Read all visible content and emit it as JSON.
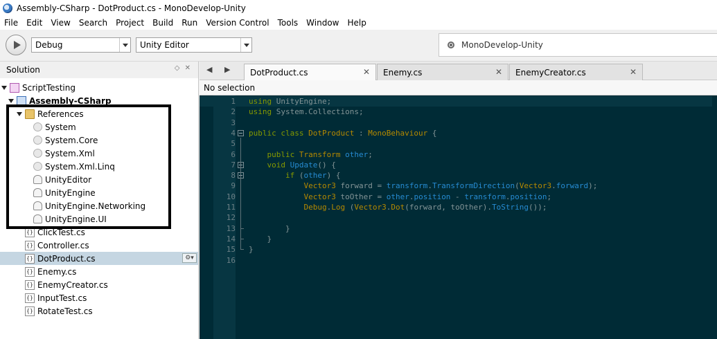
{
  "window": {
    "title": "Assembly-CSharp - DotProduct.cs - MonoDevelop-Unity"
  },
  "menu": [
    "File",
    "Edit",
    "View",
    "Search",
    "Project",
    "Build",
    "Run",
    "Version Control",
    "Tools",
    "Window",
    "Help"
  ],
  "toolbar": {
    "config": "Debug",
    "target": "Unity Editor",
    "status": "MonoDevelop-Unity"
  },
  "solution": {
    "title": "Solution",
    "controls": "◇ ✕",
    "solution_name": "ScriptTesting",
    "project_name": "Assembly-CSharp",
    "references_label": "References",
    "references": [
      "System",
      "System.Core",
      "System.Xml",
      "System.Xml.Linq",
      "UnityEditor",
      "UnityEngine",
      "UnityEngine.Networking",
      "UnityEngine.UI"
    ],
    "files": [
      "ClickTest.cs",
      "Controller.cs",
      "DotProduct.cs",
      "Enemy.cs",
      "EnemyCreator.cs",
      "InputTest.cs",
      "RotateTest.cs"
    ],
    "selected_file": "DotProduct.cs"
  },
  "editor": {
    "tabs": [
      {
        "label": "DotProduct.cs",
        "active": true
      },
      {
        "label": "Enemy.cs",
        "active": false
      },
      {
        "label": "EnemyCreator.cs",
        "active": false
      }
    ],
    "selection_status": "No selection",
    "current_line": 1,
    "lines": [
      [
        [
          "kw",
          "using "
        ],
        [
          "pl",
          "UnityEngine;"
        ]
      ],
      [
        [
          "kw",
          "using "
        ],
        [
          "pl",
          "System.Collections;"
        ]
      ],
      [],
      [
        [
          "kw",
          "public class "
        ],
        [
          "ty",
          "DotProduct"
        ],
        [
          "pl",
          " : "
        ],
        [
          "ty",
          "MonoBehaviour"
        ],
        [
          "pl",
          " {"
        ]
      ],
      [],
      [
        [
          "pl",
          "    "
        ],
        [
          "kw",
          "public "
        ],
        [
          "ty",
          "Transform "
        ],
        [
          "mb",
          "other"
        ],
        [
          "pl",
          ";"
        ]
      ],
      [
        [
          "pl",
          "    "
        ],
        [
          "kw",
          "void "
        ],
        [
          "mb",
          "Update"
        ],
        [
          "pl",
          "() {"
        ]
      ],
      [
        [
          "pl",
          "        "
        ],
        [
          "kw",
          "if "
        ],
        [
          "pl",
          "("
        ],
        [
          "mb",
          "other"
        ],
        [
          "pl",
          ") {"
        ]
      ],
      [
        [
          "pl",
          "            "
        ],
        [
          "ty",
          "Vector3 "
        ],
        [
          "pl",
          "forward = "
        ],
        [
          "mb",
          "transform"
        ],
        [
          "pl",
          "."
        ],
        [
          "mb",
          "TransformDirection"
        ],
        [
          "pl",
          "("
        ],
        [
          "ty",
          "Vector3"
        ],
        [
          "pl",
          "."
        ],
        [
          "mb",
          "forward"
        ],
        [
          "pl",
          ");"
        ]
      ],
      [
        [
          "pl",
          "            "
        ],
        [
          "ty",
          "Vector3 "
        ],
        [
          "pl",
          "toOther = "
        ],
        [
          "mb",
          "other"
        ],
        [
          "pl",
          "."
        ],
        [
          "mb",
          "position"
        ],
        [
          "pl",
          " - "
        ],
        [
          "mb",
          "transform"
        ],
        [
          "pl",
          "."
        ],
        [
          "mb",
          "position"
        ],
        [
          "pl",
          ";"
        ]
      ],
      [
        [
          "pl",
          "            "
        ],
        [
          "ty",
          "Debug"
        ],
        [
          "pl",
          "."
        ],
        [
          "ty",
          "Log"
        ],
        [
          "pl",
          " ("
        ],
        [
          "ty",
          "Vector3"
        ],
        [
          "pl",
          "."
        ],
        [
          "ty",
          "Dot"
        ],
        [
          "pl",
          "(forward, toOther)."
        ],
        [
          "mb",
          "ToString"
        ],
        [
          "pl",
          "());"
        ]
      ],
      [],
      [
        [
          "pl",
          "        }"
        ]
      ],
      [
        [
          "pl",
          "    }"
        ]
      ],
      [
        [
          "pl",
          "}"
        ]
      ],
      []
    ]
  }
}
